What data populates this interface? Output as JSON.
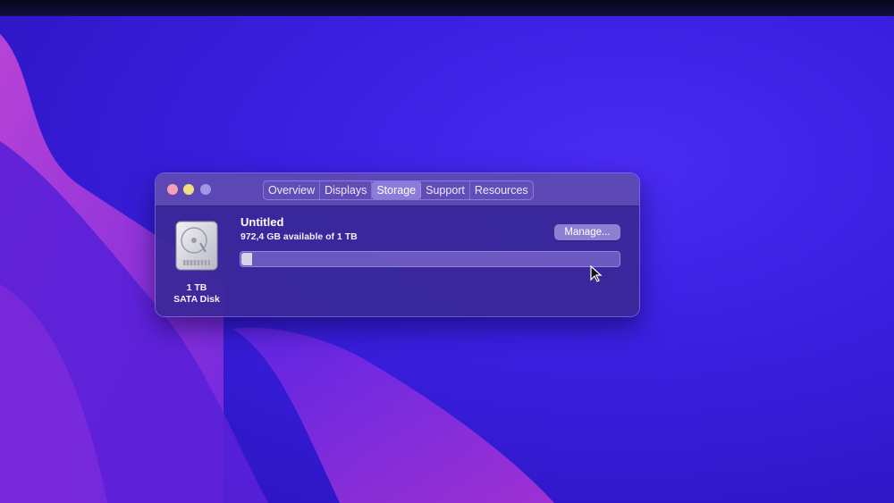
{
  "window": {
    "tabs": [
      {
        "label": "Overview"
      },
      {
        "label": "Displays"
      },
      {
        "label": "Storage"
      },
      {
        "label": "Support"
      },
      {
        "label": "Resources"
      }
    ],
    "active_tab": "Storage"
  },
  "disk": {
    "icon": "hard-drive-icon",
    "capacity_label": "1 TB",
    "type_label": "SATA Disk"
  },
  "volume": {
    "name": "Untitled",
    "availability": "972,4 GB available of 1 TB",
    "used_fraction": 0.028,
    "manage_label": "Manage..."
  },
  "colors": {
    "accent": "#3a1fe0",
    "window_bg": "#3a2896",
    "close": "#f3a0b8",
    "minimize": "#f5dc84",
    "maximize": "#a294e8"
  }
}
